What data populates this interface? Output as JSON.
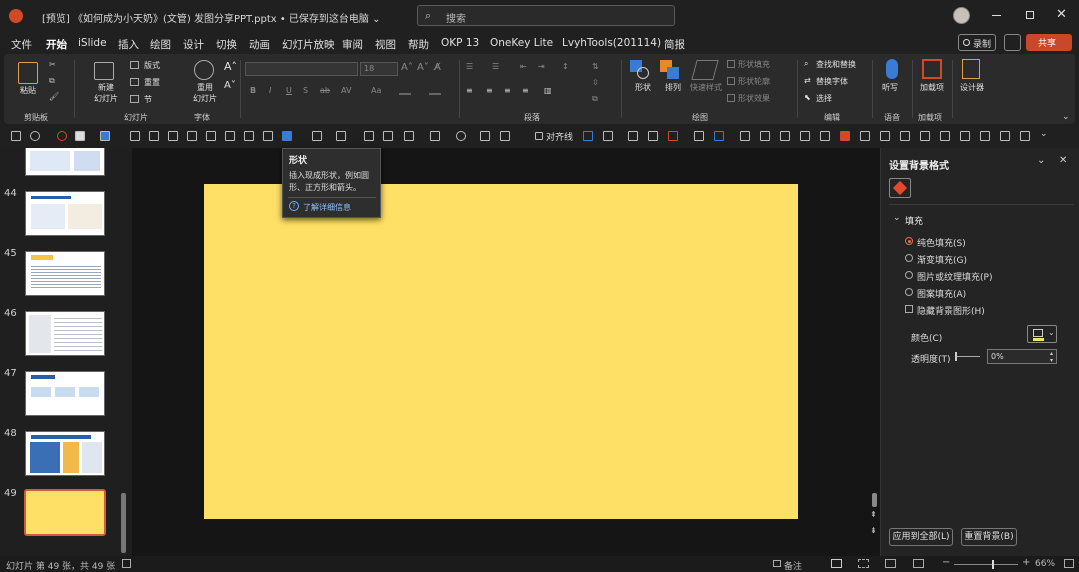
{
  "titlebar": {
    "app_icon": "wps-presentation-icon",
    "title": "[预览] 《如何成为小天奶》(文管) 发图分享PPT.pptx • 已保存到这台电脑 ⌄",
    "search_placeholder": "搜索",
    "window_controls": [
      "minimize",
      "restore",
      "close"
    ]
  },
  "menu": {
    "items": [
      "文件",
      "开始",
      "iSlide",
      "插入",
      "绘图",
      "设计",
      "切换",
      "动画",
      "幻灯片放映",
      "审阅",
      "视图",
      "帮助",
      "OKP 13",
      "OneKey Lite",
      "LvyhTools(201114)",
      "简报"
    ],
    "active": "开始",
    "record_label": "录制",
    "share_label": "共享"
  },
  "ribbon": {
    "groups": {
      "clipboard": "剪贴板",
      "slides": "幻灯片",
      "font": "字体",
      "paragraph": "段落",
      "drawing": "绘图",
      "editing": "编辑",
      "voice": "语音",
      "addins": "加载项"
    },
    "paste_label": "粘贴",
    "new_slide_label": "新建\n幻灯片",
    "layout_label": "版式",
    "reset_label": "重置",
    "section_label": "节",
    "reuse_label": "重用\n幻灯片",
    "font_size": "18",
    "shapes_label": "形状",
    "arrange_label": "排列",
    "quick_styles_label": "快速样式",
    "shape_fill_label": "形状填充",
    "shape_outline_label": "形状轮廓",
    "shape_effects_label": "形状效果",
    "find_label": "查找和替换",
    "replace_label": "替换字体",
    "select_label": "选择",
    "dictate_label": "听写",
    "addins_label": "加载项",
    "designer_label": "设计器"
  },
  "qat": {
    "align_label": "对齐线"
  },
  "tooltip": {
    "title": "形状",
    "body": "插入现成形状，例如圆形、正方形和箭头。",
    "link": "了解详细信息"
  },
  "thumbnails": {
    "numbers": [
      "44",
      "45",
      "46",
      "47",
      "48",
      "49"
    ],
    "selected": "49"
  },
  "slide": {
    "background_color": "#FFE066"
  },
  "pane": {
    "title": "设置背景格式",
    "section": "填充",
    "options": [
      "纯色填充(S)",
      "渐变填充(G)",
      "图片或纹理填充(P)",
      "图案填充(A)",
      "隐藏背景图形(H)"
    ],
    "selected_option": "纯色填充(S)",
    "color_label": "颜色(C)",
    "transparency_label": "透明度(T)",
    "transparency_value": "0%",
    "apply_all_label": "应用到全部(L)",
    "reset_label": "重置背景(B)"
  },
  "status": {
    "slide_count": "幻灯片 第 49 张，共 49 张",
    "notes_label": "备注",
    "zoom": "66%"
  }
}
